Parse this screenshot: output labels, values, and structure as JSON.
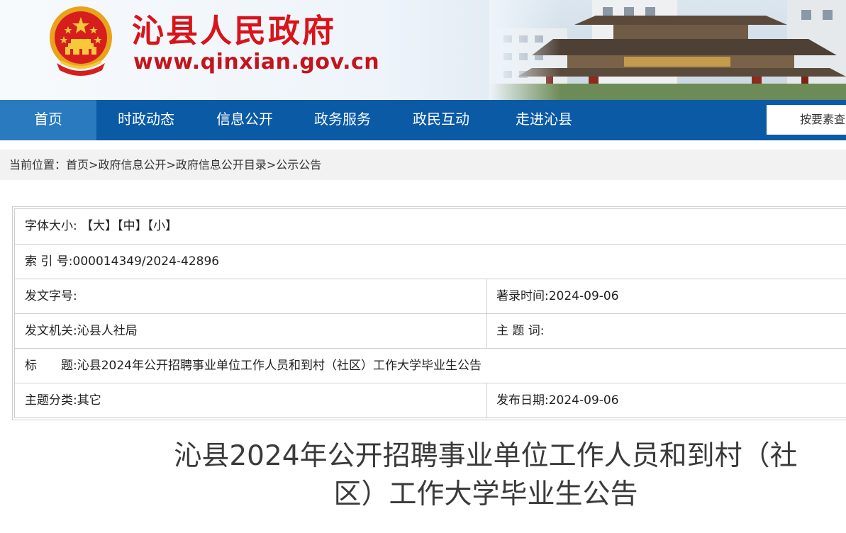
{
  "header": {
    "site_title": "沁县人民政府",
    "site_url": "www.qinxian.gov.cn",
    "colors": {
      "title_red": "#d8141a",
      "nav_blue": "#0a5aa5",
      "nav_active": "#2a7ac0"
    }
  },
  "nav": {
    "items": [
      {
        "label": "首页",
        "active": true
      },
      {
        "label": "时政动态"
      },
      {
        "label": "信息公开"
      },
      {
        "label": "政务服务"
      },
      {
        "label": "政民互动"
      },
      {
        "label": "走进沁县"
      }
    ],
    "search_placeholder": "按要素查"
  },
  "breadcrumb": {
    "prefix": "当前位置：",
    "items": [
      "首页",
      "政府信息公开",
      "政府信息公开目录",
      "公示公告"
    ],
    "separator": ">"
  },
  "meta": {
    "font_size_label": "字体大小:",
    "font_sizes": [
      "【大】",
      "【中】",
      "【小】"
    ],
    "index_label": "索 引 号:",
    "index_value": "000014349/2024-42896",
    "doc_no_label": "发文字号:",
    "doc_no_value": "",
    "record_time_label": "著录时间:",
    "record_time_value": "2024-09-06",
    "issuer_label": "发文机关:",
    "issuer_value": "沁县人社局",
    "keywords_label": "主 题 词:",
    "keywords_value": "",
    "title_label": "标　　题:",
    "title_value": "沁县2024年公开招聘事业单位工作人员和到村（社区）工作大学毕业生公告",
    "category_label": "主题分类:",
    "category_value": "其它",
    "publish_date_label": "发布日期:",
    "publish_date_value": "2024-09-06"
  },
  "article": {
    "title_line1": "沁县2024年公开招聘事业单位工作人员和到村（社",
    "title_line2": "区）工作大学毕业生公告"
  }
}
